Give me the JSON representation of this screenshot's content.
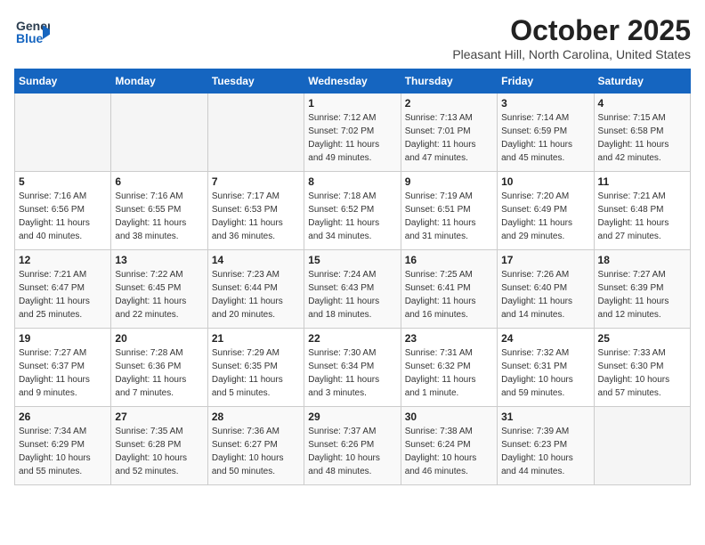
{
  "logo": {
    "line1": "General",
    "line2": "Blue"
  },
  "title": "October 2025",
  "location": "Pleasant Hill, North Carolina, United States",
  "days_of_week": [
    "Sunday",
    "Monday",
    "Tuesday",
    "Wednesday",
    "Thursday",
    "Friday",
    "Saturday"
  ],
  "weeks": [
    [
      {
        "day": "",
        "info": ""
      },
      {
        "day": "",
        "info": ""
      },
      {
        "day": "",
        "info": ""
      },
      {
        "day": "1",
        "info": "Sunrise: 7:12 AM\nSunset: 7:02 PM\nDaylight: 11 hours\nand 49 minutes."
      },
      {
        "day": "2",
        "info": "Sunrise: 7:13 AM\nSunset: 7:01 PM\nDaylight: 11 hours\nand 47 minutes."
      },
      {
        "day": "3",
        "info": "Sunrise: 7:14 AM\nSunset: 6:59 PM\nDaylight: 11 hours\nand 45 minutes."
      },
      {
        "day": "4",
        "info": "Sunrise: 7:15 AM\nSunset: 6:58 PM\nDaylight: 11 hours\nand 42 minutes."
      }
    ],
    [
      {
        "day": "5",
        "info": "Sunrise: 7:16 AM\nSunset: 6:56 PM\nDaylight: 11 hours\nand 40 minutes."
      },
      {
        "day": "6",
        "info": "Sunrise: 7:16 AM\nSunset: 6:55 PM\nDaylight: 11 hours\nand 38 minutes."
      },
      {
        "day": "7",
        "info": "Sunrise: 7:17 AM\nSunset: 6:53 PM\nDaylight: 11 hours\nand 36 minutes."
      },
      {
        "day": "8",
        "info": "Sunrise: 7:18 AM\nSunset: 6:52 PM\nDaylight: 11 hours\nand 34 minutes."
      },
      {
        "day": "9",
        "info": "Sunrise: 7:19 AM\nSunset: 6:51 PM\nDaylight: 11 hours\nand 31 minutes."
      },
      {
        "day": "10",
        "info": "Sunrise: 7:20 AM\nSunset: 6:49 PM\nDaylight: 11 hours\nand 29 minutes."
      },
      {
        "day": "11",
        "info": "Sunrise: 7:21 AM\nSunset: 6:48 PM\nDaylight: 11 hours\nand 27 minutes."
      }
    ],
    [
      {
        "day": "12",
        "info": "Sunrise: 7:21 AM\nSunset: 6:47 PM\nDaylight: 11 hours\nand 25 minutes."
      },
      {
        "day": "13",
        "info": "Sunrise: 7:22 AM\nSunset: 6:45 PM\nDaylight: 11 hours\nand 22 minutes."
      },
      {
        "day": "14",
        "info": "Sunrise: 7:23 AM\nSunset: 6:44 PM\nDaylight: 11 hours\nand 20 minutes."
      },
      {
        "day": "15",
        "info": "Sunrise: 7:24 AM\nSunset: 6:43 PM\nDaylight: 11 hours\nand 18 minutes."
      },
      {
        "day": "16",
        "info": "Sunrise: 7:25 AM\nSunset: 6:41 PM\nDaylight: 11 hours\nand 16 minutes."
      },
      {
        "day": "17",
        "info": "Sunrise: 7:26 AM\nSunset: 6:40 PM\nDaylight: 11 hours\nand 14 minutes."
      },
      {
        "day": "18",
        "info": "Sunrise: 7:27 AM\nSunset: 6:39 PM\nDaylight: 11 hours\nand 12 minutes."
      }
    ],
    [
      {
        "day": "19",
        "info": "Sunrise: 7:27 AM\nSunset: 6:37 PM\nDaylight: 11 hours\nand 9 minutes."
      },
      {
        "day": "20",
        "info": "Sunrise: 7:28 AM\nSunset: 6:36 PM\nDaylight: 11 hours\nand 7 minutes."
      },
      {
        "day": "21",
        "info": "Sunrise: 7:29 AM\nSunset: 6:35 PM\nDaylight: 11 hours\nand 5 minutes."
      },
      {
        "day": "22",
        "info": "Sunrise: 7:30 AM\nSunset: 6:34 PM\nDaylight: 11 hours\nand 3 minutes."
      },
      {
        "day": "23",
        "info": "Sunrise: 7:31 AM\nSunset: 6:32 PM\nDaylight: 11 hours\nand 1 minute."
      },
      {
        "day": "24",
        "info": "Sunrise: 7:32 AM\nSunset: 6:31 PM\nDaylight: 10 hours\nand 59 minutes."
      },
      {
        "day": "25",
        "info": "Sunrise: 7:33 AM\nSunset: 6:30 PM\nDaylight: 10 hours\nand 57 minutes."
      }
    ],
    [
      {
        "day": "26",
        "info": "Sunrise: 7:34 AM\nSunset: 6:29 PM\nDaylight: 10 hours\nand 55 minutes."
      },
      {
        "day": "27",
        "info": "Sunrise: 7:35 AM\nSunset: 6:28 PM\nDaylight: 10 hours\nand 52 minutes."
      },
      {
        "day": "28",
        "info": "Sunrise: 7:36 AM\nSunset: 6:27 PM\nDaylight: 10 hours\nand 50 minutes."
      },
      {
        "day": "29",
        "info": "Sunrise: 7:37 AM\nSunset: 6:26 PM\nDaylight: 10 hours\nand 48 minutes."
      },
      {
        "day": "30",
        "info": "Sunrise: 7:38 AM\nSunset: 6:24 PM\nDaylight: 10 hours\nand 46 minutes."
      },
      {
        "day": "31",
        "info": "Sunrise: 7:39 AM\nSunset: 6:23 PM\nDaylight: 10 hours\nand 44 minutes."
      },
      {
        "day": "",
        "info": ""
      }
    ]
  ]
}
